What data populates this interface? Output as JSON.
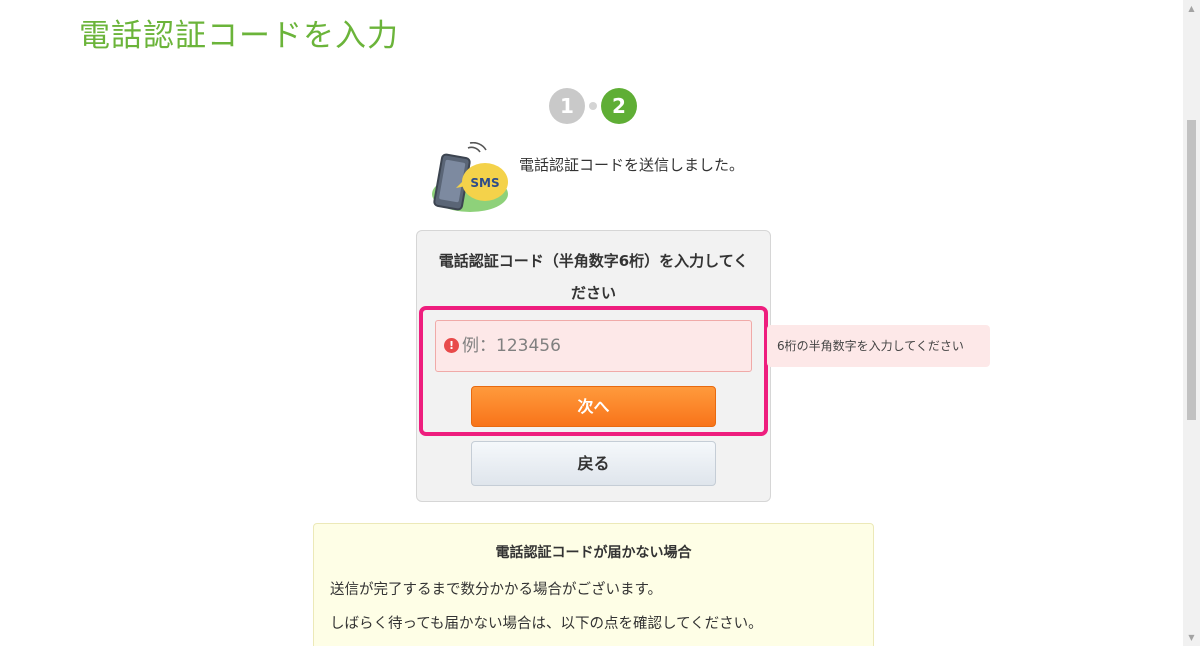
{
  "page": {
    "title": "電話認証コードを入力"
  },
  "steps": [
    {
      "label": "1",
      "state": "inactive"
    },
    {
      "label": "2",
      "state": "active"
    }
  ],
  "sms_icon": {
    "name": "sms-phone-icon",
    "badge_text": "SMS"
  },
  "sent_message": "電話認証コードを送信しました。",
  "form": {
    "prompt": "電話認証コード（半角数字6桁）を入力してください",
    "input_placeholder": "例：123456",
    "input_value": "",
    "error_icon_glyph": "!",
    "error_message": "6桁の半角数字を入力してください",
    "next_label": "次へ",
    "back_label": "戻る"
  },
  "notice": {
    "title": "電話認証コードが届かない場合",
    "line1": "送信が完了するまで数分かかる場合がございます。",
    "line2": "しばらく待っても届かない場合は、以下の点を確認してください。"
  },
  "colors": {
    "title_green": "#6bb43a",
    "step_active": "#5fae35",
    "step_inactive": "#c9c9c9",
    "highlight": "#ee1e7e",
    "next_button": "#f8741a",
    "error_bg": "#fde8e8",
    "notice_bg": "#fefee6"
  }
}
